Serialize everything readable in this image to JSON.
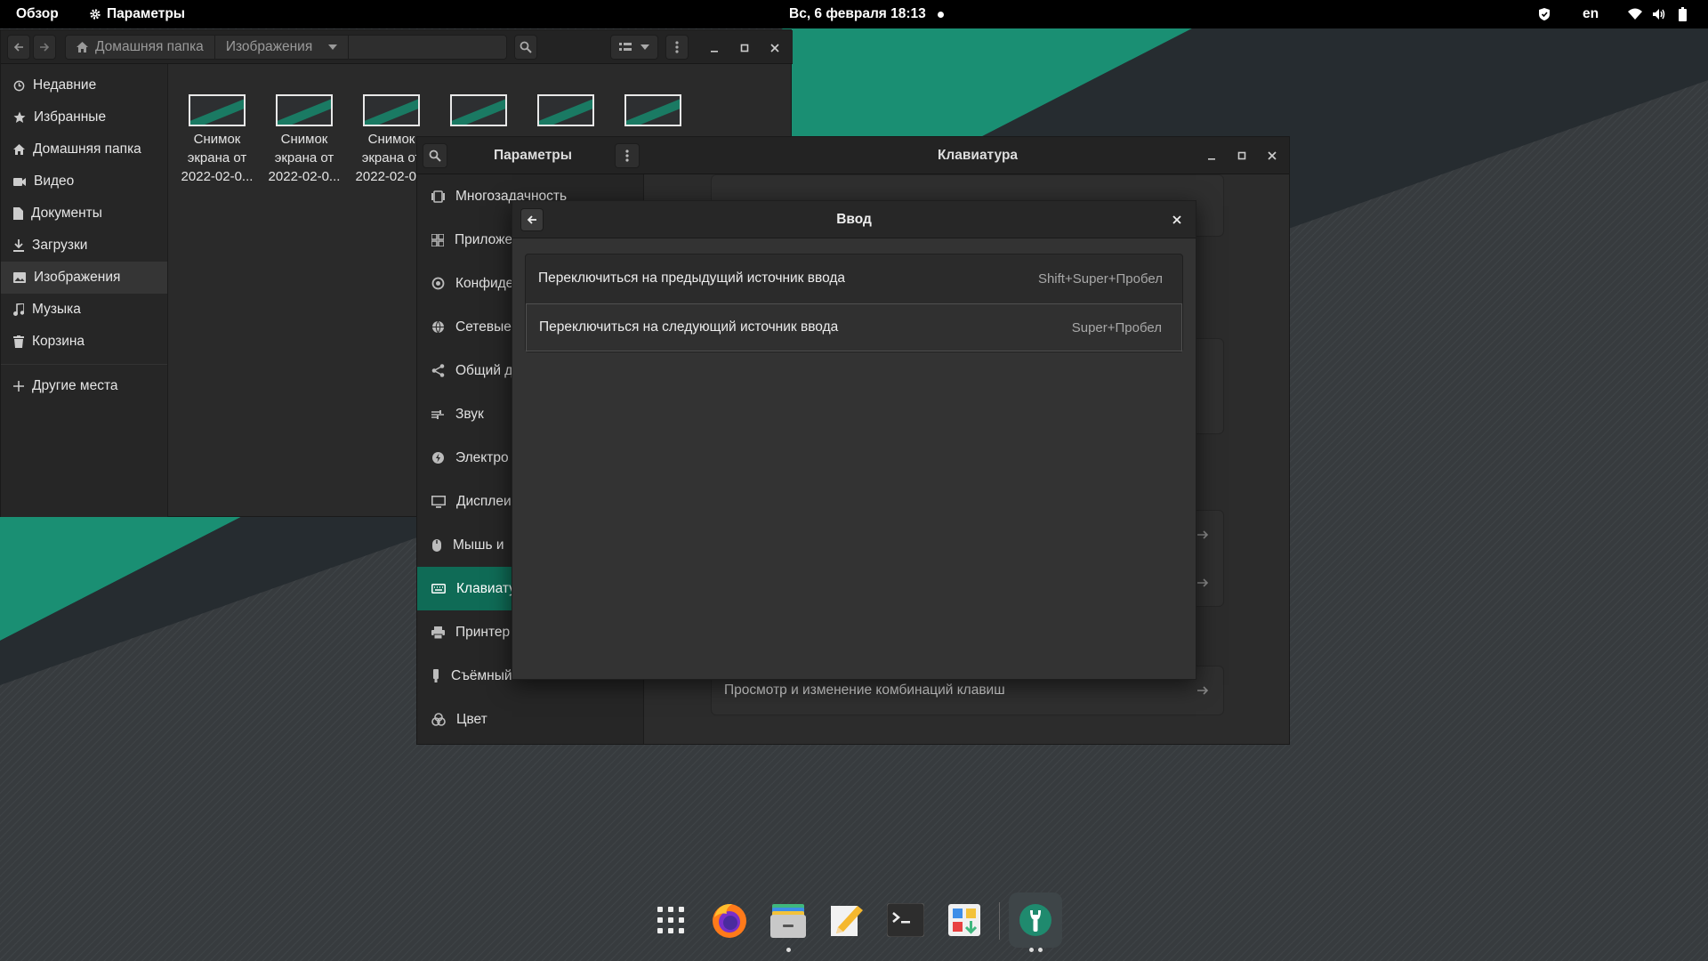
{
  "topbar": {
    "overview": "Обзор",
    "app_menu": "Параметры",
    "clock": "Вс, 6 февраля  18:13",
    "language": "en"
  },
  "files": {
    "breadcrumbs": [
      "Домашняя папка",
      "Изображения"
    ],
    "sidebar": [
      {
        "label": "Недавние",
        "icon": "clock-icon"
      },
      {
        "label": "Избранные",
        "icon": "star-icon"
      },
      {
        "label": "Домашняя папка",
        "icon": "home-icon"
      },
      {
        "label": "Видео",
        "icon": "video-icon"
      },
      {
        "label": "Документы",
        "icon": "document-icon"
      },
      {
        "label": "Загрузки",
        "icon": "download-icon"
      },
      {
        "label": "Изображения",
        "icon": "image-icon"
      },
      {
        "label": "Музыка",
        "icon": "music-icon"
      },
      {
        "label": "Корзина",
        "icon": "trash-icon"
      }
    ],
    "other_places": "Другие места",
    "thumbnails": [
      {
        "line1": "Снимок",
        "line2": "экрана от",
        "line3": "2022-02-0..."
      },
      {
        "line1": "Снимок",
        "line2": "экрана от",
        "line3": "2022-02-0..."
      },
      {
        "line1": "Снимок",
        "line2": "экрана от",
        "line3": "2022-02-0..."
      }
    ]
  },
  "settings": {
    "sidebar_title": "Параметры",
    "main_title": "Клавиатура",
    "sidebar": [
      {
        "label": "Многозадачность",
        "icon": "multitasking-icon"
      },
      {
        "label": "Приложе",
        "icon": "apps-icon"
      },
      {
        "label": "Конфиде",
        "icon": "privacy-icon"
      },
      {
        "label": "Сетевые",
        "icon": "network-icon"
      },
      {
        "label": "Общий д",
        "icon": "share-icon"
      },
      {
        "label": "Звук",
        "icon": "sound-icon"
      },
      {
        "label": "Электро",
        "icon": "power-icon"
      },
      {
        "label": "Дисплеи",
        "icon": "display-icon"
      },
      {
        "label": "Мышь и",
        "icon": "mouse-icon"
      },
      {
        "label": "Клавиату",
        "icon": "keyboard-icon"
      },
      {
        "label": "Принтер",
        "icon": "printer-icon"
      },
      {
        "label": "Съёмный",
        "icon": "removable-media-icon"
      },
      {
        "label": "Цвет",
        "icon": "color-icon"
      }
    ],
    "shortcut_card": "Просмотр и изменение комбинаций клавиш"
  },
  "dialog": {
    "title": "Ввод",
    "rows": [
      {
        "label": "Переключиться на предыдущий источник ввода",
        "accel": "Shift+Super+Пробел"
      },
      {
        "label": "Переключиться на следующий источник ввода",
        "accel": "Super+Пробел"
      }
    ]
  },
  "dock": {
    "items": [
      "app-grid-icon",
      "firefox-icon",
      "files-icon",
      "text-editor-icon",
      "terminal-icon",
      "software-center-icon",
      "settings-icon"
    ]
  },
  "colors": {
    "accent": "#0f6b56",
    "wallpaper_green": "#1e8a70",
    "wallpaper_dark": "#2e3336"
  }
}
